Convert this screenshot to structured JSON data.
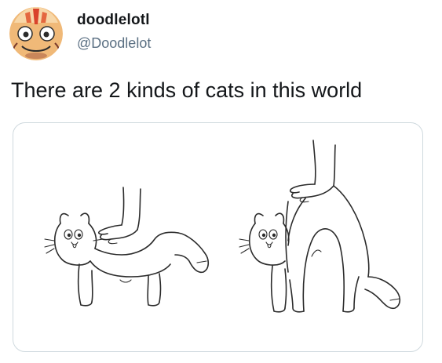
{
  "tweet": {
    "display_name": "doodlelotl",
    "handle": "@Doodlelot",
    "text": "There are 2 kinds of cats in this world"
  },
  "icons": {
    "avatar": "axolotl-face-avatar-icon"
  },
  "colors": {
    "avatar_bg": "#f0b978",
    "avatar_accent": "#d9432b",
    "text": "#14171a",
    "muted": "#5b7083",
    "border": "#cfd9de"
  }
}
